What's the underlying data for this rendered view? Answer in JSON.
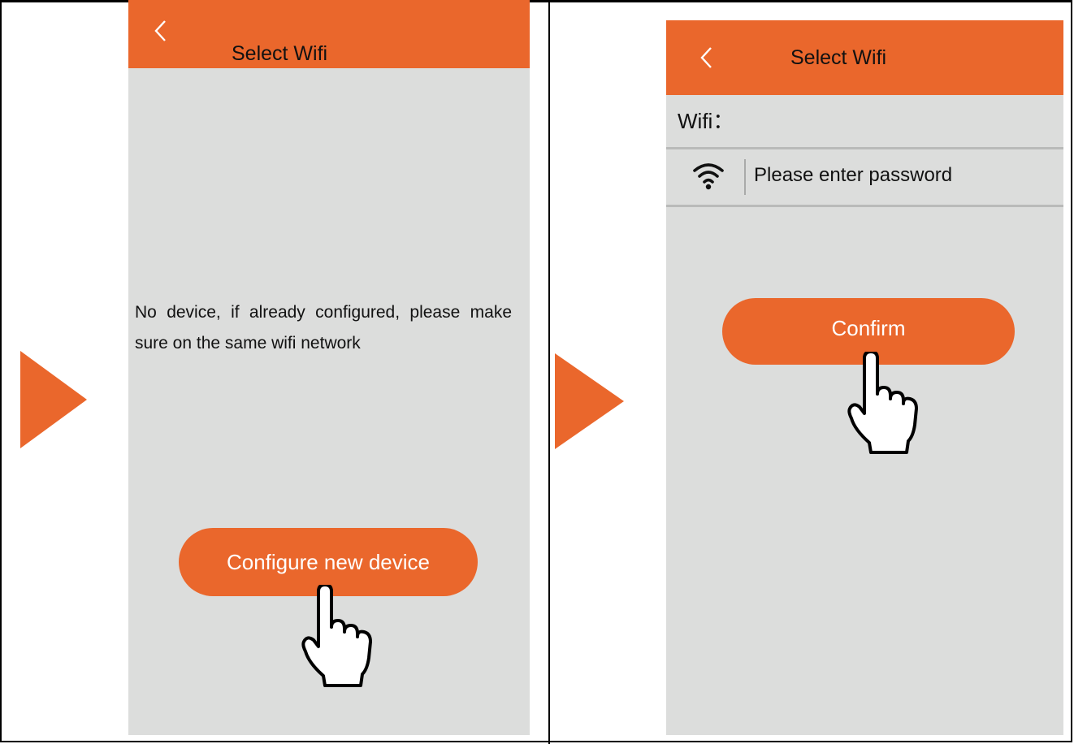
{
  "left_screen": {
    "header": {
      "title": "Select Wifi",
      "back_icon": "chevron-left-icon"
    },
    "message": "No device, if already configured, please make sure on the same wifi network",
    "configure_button": "Configure new device"
  },
  "right_screen": {
    "header": {
      "title": "Select Wifi",
      "back_icon": "chevron-left-icon"
    },
    "wifi_label": "Wifi：",
    "password_placeholder": "Please enter password",
    "confirm_button": "Confirm"
  },
  "colors": {
    "accent": "#ea672c",
    "screen_bg": "#dcdddc",
    "divider": "#b9bab9"
  },
  "icons": [
    "play-arrow-icon",
    "chevron-left-icon",
    "wifi-icon",
    "pointing-hand-icon"
  ]
}
